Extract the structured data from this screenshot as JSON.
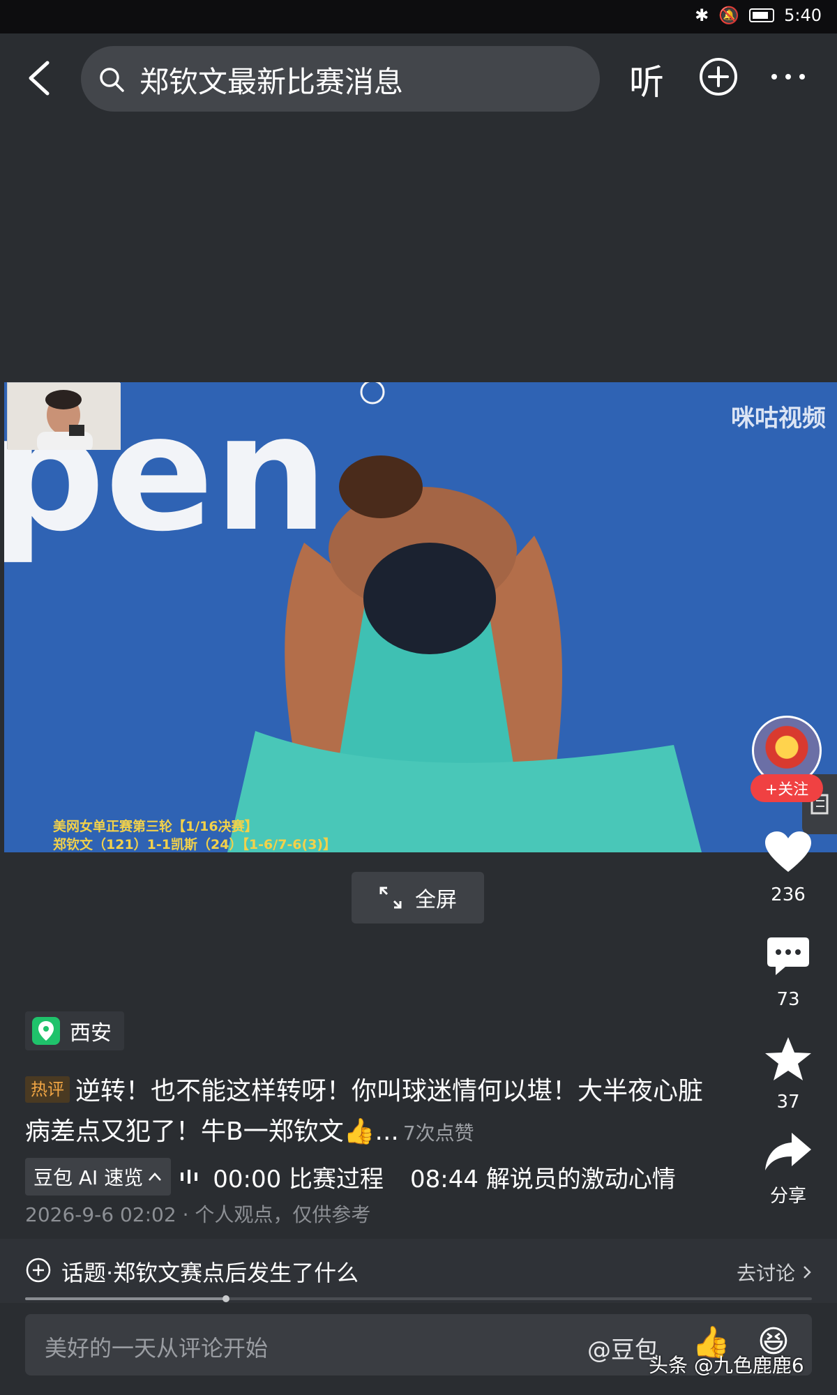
{
  "status_bar": {
    "time": "5:40"
  },
  "top_bar": {
    "search_query": "郑钦文最新比赛消息",
    "listen_label": "听"
  },
  "video": {
    "watermark": "咪咕视频",
    "score_line_1": "美网女单正赛第三轮【1/16决赛】",
    "score_line_2": "郑钦文（121）1-1凯斯（24）【1-6/7-6(3)】",
    "fullscreen_label": "全屏"
  },
  "side_actions": {
    "follow_label": "+关注",
    "likes": "236",
    "comments": "73",
    "favorites": "37",
    "share_label": "分享"
  },
  "location": "西安",
  "hot_comment": {
    "tag": "热评",
    "text": "逆转！也不能这样转呀！你叫球迷情何以堪！大半夜心脏病差点又犯了！牛B一郑钦文👍...",
    "likes": "7次点赞"
  },
  "ai_summary": {
    "badge": "豆包 AI 速览",
    "chapters": [
      {
        "time": "00:00",
        "title": "比赛过程"
      },
      {
        "time": "08:44",
        "title": "解说员的激动心情"
      }
    ]
  },
  "meta": "2026-9-6 02:02 · 个人观点，仅供参考",
  "topic": {
    "title": "话题·郑钦文赛点后发生了什么",
    "link": "去讨论"
  },
  "playback_progress": 0.255,
  "comment_bar": {
    "placeholder": "美好的一天从评论开始",
    "mention": "@豆包"
  },
  "credit": "头条 @九色鹿鹿6",
  "colors": {
    "background": "#2a2d31",
    "follow_red": "#f04142",
    "hot_tag": "#f0a544",
    "location_green": "#1fc26b"
  }
}
